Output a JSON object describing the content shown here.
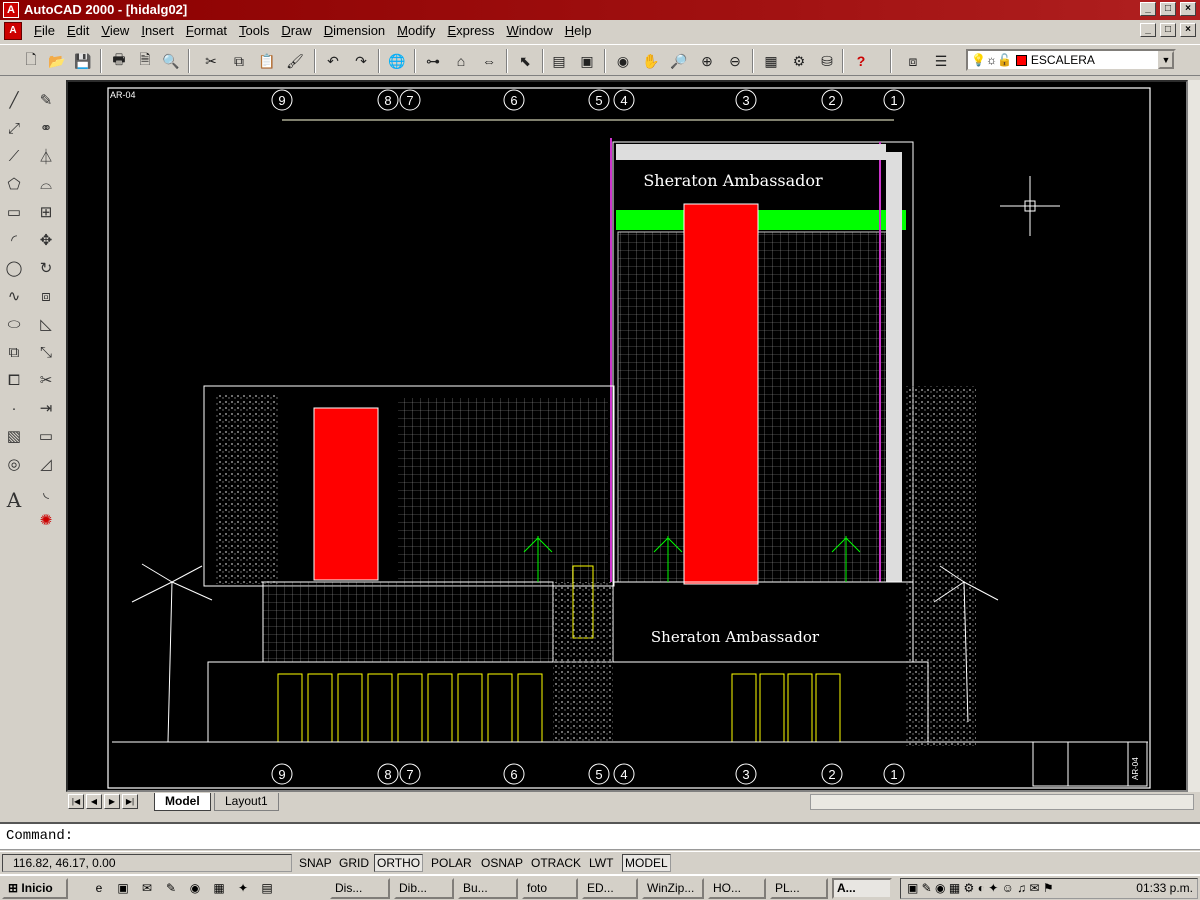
{
  "window": {
    "title": "AutoCAD 2000 - [hidalg02]",
    "controls": [
      "_",
      "□",
      "×"
    ]
  },
  "menu": [
    "File",
    "Edit",
    "View",
    "Insert",
    "Format",
    "Tools",
    "Draw",
    "Dimension",
    "Modify",
    "Express",
    "Window",
    "Help"
  ],
  "layer": {
    "name": "ESCALERA",
    "color": "#ff0000"
  },
  "drawing": {
    "sheet_label": "AR-04",
    "grid_top": [
      "9",
      "8",
      "7",
      "6",
      "5",
      "4",
      "3",
      "2",
      "1"
    ],
    "grid_bottom": [
      "9",
      "8",
      "7",
      "6",
      "5",
      "4",
      "3",
      "2",
      "1"
    ],
    "sign_top": "Sheraton Ambassador",
    "sign_bottom": "Sheraton Ambassador",
    "titleblock_label": "AR-04",
    "colors": {
      "background": "#000000",
      "linework": "#ffffff",
      "accent_red": "#ff0000",
      "accent_green": "#00ff00",
      "accent_magenta": "#cc33cc",
      "accent_yellow": "#ffff00"
    }
  },
  "tabs": {
    "model": "Model",
    "layout1": "Layout1"
  },
  "command": {
    "prompt": "Command:"
  },
  "status": {
    "coords": "116.82, 46.17, 0.00",
    "snap": "SNAP",
    "grid": "GRID",
    "ortho": "ORTHO",
    "polar": "POLAR",
    "osnap": "OSNAP",
    "otrack": "OTRACK",
    "lwt": "LWT",
    "model": "MODEL"
  },
  "taskbar": {
    "start": "Inicio",
    "tasks": [
      "Dis...",
      "Dib...",
      "Bu...",
      "foto",
      "ED...",
      "WinZip...",
      "HO...",
      "PL...",
      "A..."
    ],
    "clock": "01:33 p.m."
  }
}
